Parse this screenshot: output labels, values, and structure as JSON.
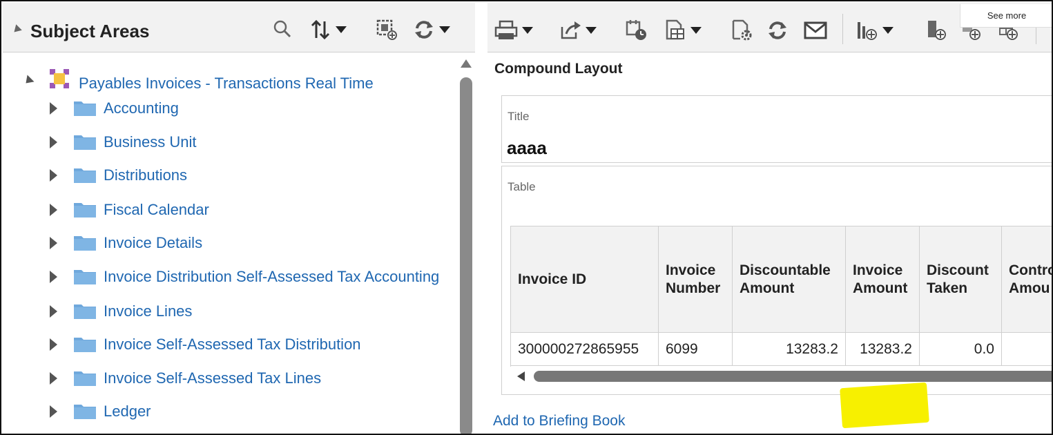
{
  "subject_areas": {
    "title": "Subject Areas",
    "root": {
      "label": "Payables Invoices - Transactions Real Time"
    },
    "folders": [
      {
        "label": "Accounting"
      },
      {
        "label": "Business Unit"
      },
      {
        "label": "Distributions"
      },
      {
        "label": "Fiscal Calendar"
      },
      {
        "label": "Invoice Details"
      },
      {
        "label": "Invoice Distribution Self-Assessed Tax Accounting"
      },
      {
        "label": "Invoice Lines"
      },
      {
        "label": "Invoice Self-Assessed Tax Distribution"
      },
      {
        "label": "Invoice Self-Assessed Tax Lines"
      },
      {
        "label": "Ledger"
      }
    ],
    "toolbar_icons": [
      "search-icon",
      "sort-icon",
      "add-view-icon",
      "refresh-icon"
    ]
  },
  "editor": {
    "see_more": "See more",
    "toolbar_icons": [
      "print-icon",
      "export-icon",
      "schedule-icon",
      "view-properties-icon",
      "settings-icon",
      "refresh-icon",
      "email-icon",
      "add-chart-icon",
      "add-column-icon",
      "add-row-icon",
      "add-grid-icon"
    ],
    "compound_layout": "Compound Layout",
    "title_view": {
      "caption": "Title",
      "value": "aaaa"
    },
    "table_view": {
      "caption": "Table",
      "headers": [
        "Invoice ID",
        "Invoice\nNumber",
        "Discountable\nAmount",
        "Invoice\nAmount",
        "Discount\nTaken",
        "Contro\nAmou"
      ],
      "rows": [
        [
          "300000272865955",
          "6099",
          "13283.2",
          "13283.2",
          "0.0",
          ""
        ]
      ],
      "highlighted_value": "13283.2"
    },
    "add_to_briefing_book": "Add to Briefing Book"
  },
  "colors": {
    "link": "#1f67b1",
    "header_bg": "#f2f2f2",
    "highlight": "#f7f000",
    "folder": "#6fa8dc"
  }
}
